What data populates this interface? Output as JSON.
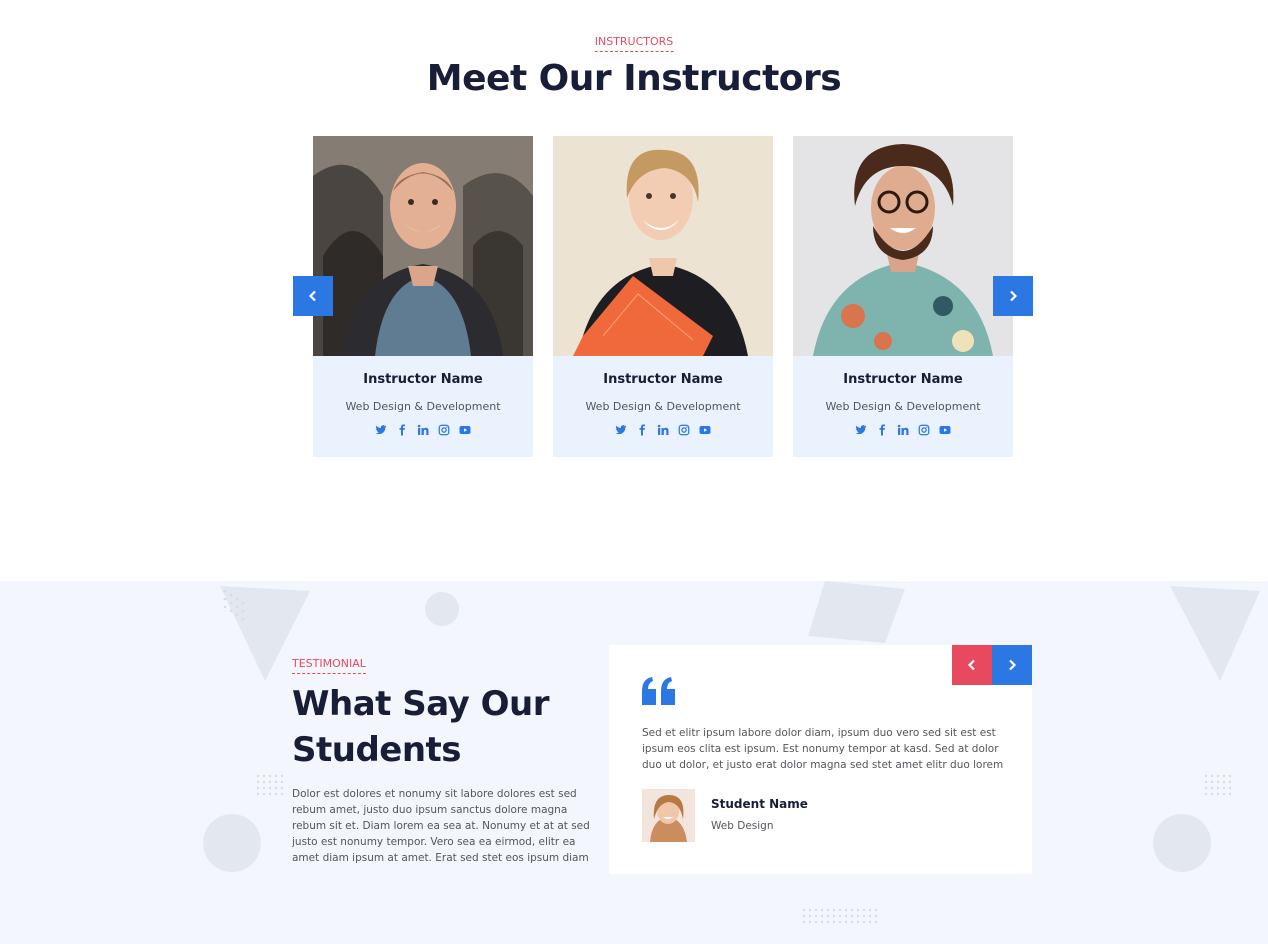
{
  "instructors": {
    "eyebrow": "INSTRUCTORS",
    "title": "Meet Our Instructors",
    "cards": [
      {
        "name": "Instructor Name",
        "role": "Web Design & Development"
      },
      {
        "name": "Instructor Name",
        "role": "Web Design & Development"
      },
      {
        "name": "Instructor Name",
        "role": "Web Design & Development"
      }
    ],
    "social_icons": [
      "twitter-icon",
      "facebook-icon",
      "linkedin-icon",
      "instagram-icon",
      "youtube-icon"
    ],
    "prev_icon": "chevron-left-icon",
    "next_icon": "chevron-right-icon"
  },
  "testimonials": {
    "eyebrow": "TESTIMONIAL",
    "title_line1": "What Say Our",
    "title_line2": "Students",
    "text": "Dolor est dolores et nonumy sit labore dolores est sed rebum amet, justo duo ipsum sanctus dolore magna rebum sit et. Diam lorem ea sea at. Nonumy et at at sed justo est nonumy tempor. Vero sea ea eirmod, elitr ea amet diam ipsum at amet. Erat sed stet eos ipsum diam",
    "quote": {
      "text": "Sed et elitr ipsum labore dolor diam, ipsum duo vero sed sit est est ipsum eos clita est ipsum. Est nonumy tempor at kasd. Sed at dolor duo ut dolor, et justo erat dolor magna sed stet amet elitr duo lorem",
      "student_name": "Student Name",
      "student_role": "Web Design"
    },
    "quote_icon": "quote-left-icon"
  },
  "colors": {
    "primary": "#2b78e4",
    "accent": "#e9495f",
    "dark": "#181d38",
    "card_bg": "#eaf2fe",
    "section_bg": "#f3f6fc"
  }
}
